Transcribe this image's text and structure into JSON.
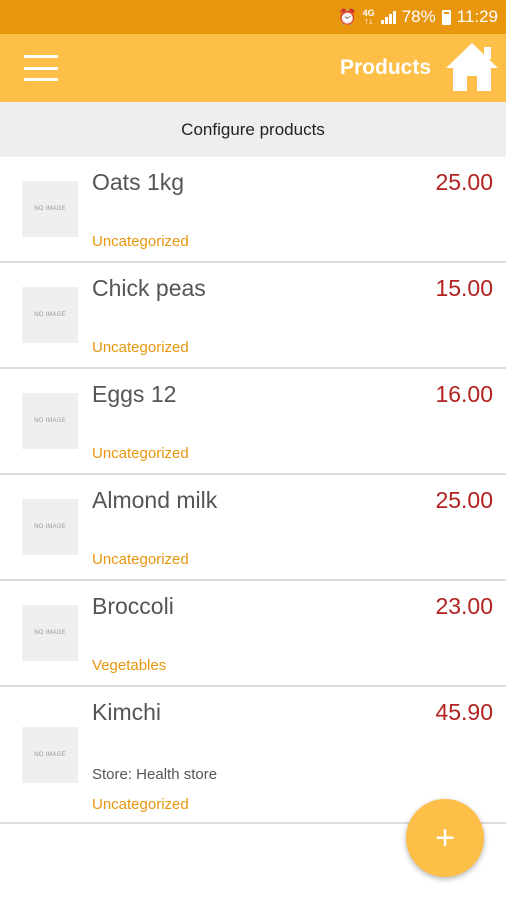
{
  "status_bar": {
    "alarm_icon": "alarm-icon",
    "network": "4G",
    "battery": "78%",
    "time": "11:29"
  },
  "app_bar": {
    "menu_icon": "menu-icon",
    "title": "Products",
    "home_icon": "home-icon"
  },
  "subheader": "Configure products",
  "products": [
    {
      "name": "Oats 1kg",
      "price": "25.00",
      "category": "Uncategorized",
      "image": "NO IMAGE"
    },
    {
      "name": "Chick peas",
      "price": "15.00",
      "category": "Uncategorized",
      "image": "NO IMAGE"
    },
    {
      "name": "Eggs 12",
      "price": "16.00",
      "category": "Uncategorized",
      "image": "NO IMAGE"
    },
    {
      "name": "Almond milk",
      "price": "25.00",
      "category": "Uncategorized",
      "image": "NO IMAGE"
    },
    {
      "name": "Broccoli",
      "price": "23.00",
      "category": "Vegetables",
      "image": "NO IMAGE"
    },
    {
      "name": "Kimchi",
      "price": "45.90",
      "store": "Store: Health store",
      "category": "Uncategorized",
      "image": "NO IMAGE"
    }
  ],
  "fab": {
    "label": "+",
    "icon": "add-icon"
  },
  "colors": {
    "status_bar": "#e8960e",
    "app_bar": "#fdbf47",
    "price": "#b22222",
    "category": "#e8960e"
  }
}
